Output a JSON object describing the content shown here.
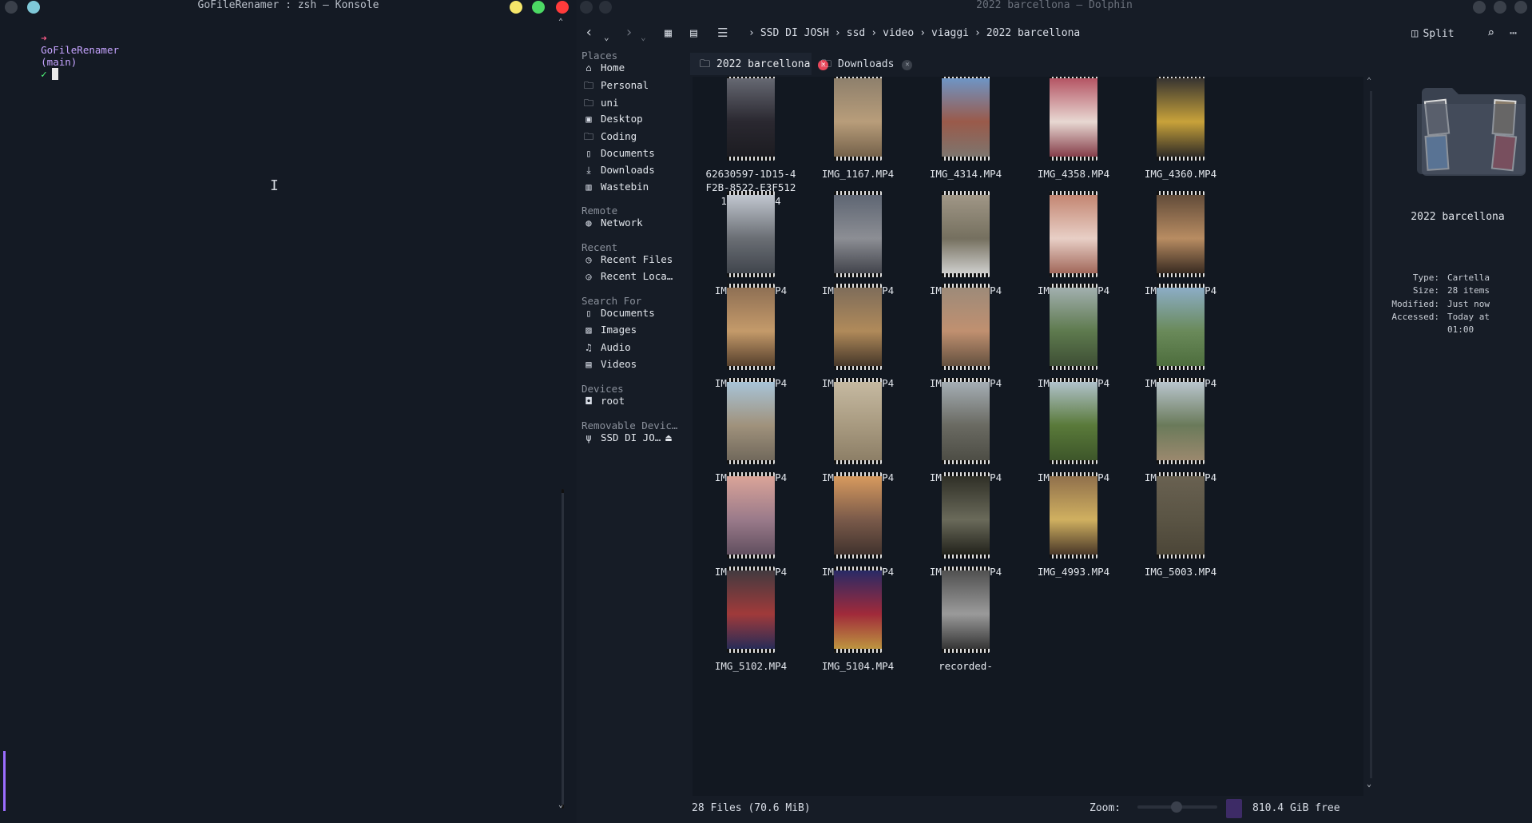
{
  "konsole": {
    "title": "GoFileRenamer : zsh — Konsole",
    "prompt_arrow": "➜",
    "prompt_dir": "GoFileRenamer",
    "prompt_branch": "(main)",
    "prompt_check": "✓"
  },
  "dolphin": {
    "title": "2022 barcellona — Dolphin",
    "breadcrumbs": [
      "SSD DI JOSH",
      "ssd",
      "video",
      "viaggi",
      "2022 barcellona"
    ],
    "split_label": "Split",
    "places": {
      "headers": {
        "places": "Places",
        "remote": "Remote",
        "recent": "Recent",
        "search": "Search For",
        "devices": "Devices",
        "removable": "Removable Devic…"
      },
      "places_items": [
        {
          "label": "Home",
          "icon": "home-icon"
        },
        {
          "label": "Personal",
          "icon": "folder-icon"
        },
        {
          "label": "uni",
          "icon": "folder-icon"
        },
        {
          "label": "Desktop",
          "icon": "desktop-icon"
        },
        {
          "label": "Coding",
          "icon": "folder-icon"
        },
        {
          "label": "Documents",
          "icon": "document-icon"
        },
        {
          "label": "Downloads",
          "icon": "download-icon"
        },
        {
          "label": "Wastebin",
          "icon": "trash-icon"
        }
      ],
      "remote_items": [
        {
          "label": "Network",
          "icon": "network-icon"
        }
      ],
      "recent_items": [
        {
          "label": "Recent Files",
          "icon": "recent-files-icon"
        },
        {
          "label": "Recent Loca…",
          "icon": "recent-locations-icon"
        }
      ],
      "search_items": [
        {
          "label": "Documents",
          "icon": "document-icon"
        },
        {
          "label": "Images",
          "icon": "image-icon"
        },
        {
          "label": "Audio",
          "icon": "music-icon"
        },
        {
          "label": "Videos",
          "icon": "video-icon"
        }
      ],
      "devices_items": [
        {
          "label": "root",
          "icon": "drive-icon"
        }
      ],
      "removable_items": [
        {
          "label": "SSD DI JO…",
          "icon": "usb-icon"
        }
      ]
    },
    "tabs": [
      {
        "label": "2022 barcellona",
        "active": true
      },
      {
        "label": "Downloads",
        "active": false
      }
    ],
    "files": [
      {
        "name": "62630597-1D15-4F2B-8522-E3F5121424E5.MP4",
        "colors": [
          "#6b6e78",
          "#2a2830",
          "#1a1a1f"
        ]
      },
      {
        "name": "IMG_1167.MP4",
        "colors": [
          "#8a7d6b",
          "#b89d7a",
          "#6d5b45"
        ]
      },
      {
        "name": "IMG_4314.MP4",
        "colors": [
          "#6a9ad0",
          "#9a5a4a",
          "#7a7872"
        ]
      },
      {
        "name": "IMG_4358.MP4",
        "colors": [
          "#b0495a",
          "#e8d8d2",
          "#7a2c3a"
        ]
      },
      {
        "name": "IMG_4360.MP4",
        "colors": [
          "#2a2a30",
          "#c8a23a",
          "#1e1e24"
        ]
      },
      {
        "name": "IMG_4389.MP4",
        "colors": [
          "#c9cfd8",
          "#6a6e74",
          "#3b4048"
        ]
      },
      {
        "name": "IMG_4390.MP4",
        "colors": [
          "#5a6270",
          "#8c8e94",
          "#3a3c44"
        ]
      },
      {
        "name": "IMG_4392.MP4",
        "colors": [
          "#a49a8a",
          "#75705f",
          "#d8d8d8"
        ]
      },
      {
        "name": "IMG_4748.MP4",
        "colors": [
          "#c07f6a",
          "#e8cfc6",
          "#9a5c4e"
        ]
      },
      {
        "name": "IMG_4755.MP4",
        "colors": [
          "#5a4636",
          "#b88c62",
          "#2a201a"
        ]
      },
      {
        "name": "IMG_4756.MP4",
        "colors": [
          "#8a6c52",
          "#c49a6a",
          "#4a3626"
        ]
      },
      {
        "name": "IMG_4757.MP4",
        "colors": [
          "#7a6a5a",
          "#b08a5a",
          "#3a2e24"
        ]
      },
      {
        "name": "IMG_4758.MP4",
        "colors": [
          "#9a8a7a",
          "#c09070",
          "#5a4a3a"
        ]
      },
      {
        "name": "IMG_4775.MP4",
        "colors": [
          "#a8b4b8",
          "#5e7a4e",
          "#3a4a32"
        ]
      },
      {
        "name": "IMG_4776.MP4",
        "colors": [
          "#8fb0d0",
          "#6a8a5a",
          "#4a6a3a"
        ]
      },
      {
        "name": "IMG_4778.MP4",
        "colors": [
          "#a8c8e0",
          "#a0927c",
          "#6c6458"
        ]
      },
      {
        "name": "IMG_4779.MP4",
        "colors": [
          "#c8bca4",
          "#a89a80",
          "#8a7c64"
        ]
      },
      {
        "name": "IMG_4780.MP4",
        "colors": [
          "#aab4bc",
          "#6a6a62",
          "#4a4a42"
        ]
      },
      {
        "name": "IMG_4937.MP4",
        "colors": [
          "#b8c8d8",
          "#5a7a3a",
          "#3a5228"
        ]
      },
      {
        "name": "IMG_4938.MP4",
        "colors": [
          "#c0ccd8",
          "#6a7a5a",
          "#a08a70"
        ]
      },
      {
        "name": "IMG_4959.MP4",
        "colors": [
          "#e0a89a",
          "#9a7a8a",
          "#5a4a5a"
        ]
      },
      {
        "name": "IMG_4960.MP4",
        "colors": [
          "#e0a060",
          "#7a5a4a",
          "#3a2e2a"
        ]
      },
      {
        "name": "IMG_4978.MP4",
        "colors": [
          "#2a2a22",
          "#6a6a5a",
          "#1a1a14"
        ]
      },
      {
        "name": "IMG_4993.MP4",
        "colors": [
          "#8a6a4a",
          "#d0b060",
          "#3a2a22"
        ]
      },
      {
        "name": "IMG_5003.MP4",
        "colors": [
          "#6a6252",
          "#5a5444",
          "#4a4436"
        ]
      },
      {
        "name": "IMG_5102.MP4",
        "colors": [
          "#3a3a40",
          "#a03a3a",
          "#1a2a5a"
        ]
      },
      {
        "name": "IMG_5104.MP4",
        "colors": [
          "#1e2a6a",
          "#a02a3a",
          "#c0a040"
        ]
      },
      {
        "name": "recorded-",
        "colors": [
          "#4a4a4a",
          "#9a9a9a",
          "#2a2a2a"
        ]
      }
    ],
    "info": {
      "name": "2022 barcellona",
      "rows": [
        {
          "key": "Type:",
          "value": "Cartella"
        },
        {
          "key": "Size:",
          "value": "28 items"
        },
        {
          "key": "Modified:",
          "value": "Just now"
        },
        {
          "key": "Accessed:",
          "value": "Today at"
        },
        {
          "key": "",
          "value": "01:00"
        }
      ]
    },
    "status": {
      "files": "28 Files (70.6 MiB)",
      "zoom_label": "Zoom:",
      "free": "810.4 GiB free"
    }
  }
}
